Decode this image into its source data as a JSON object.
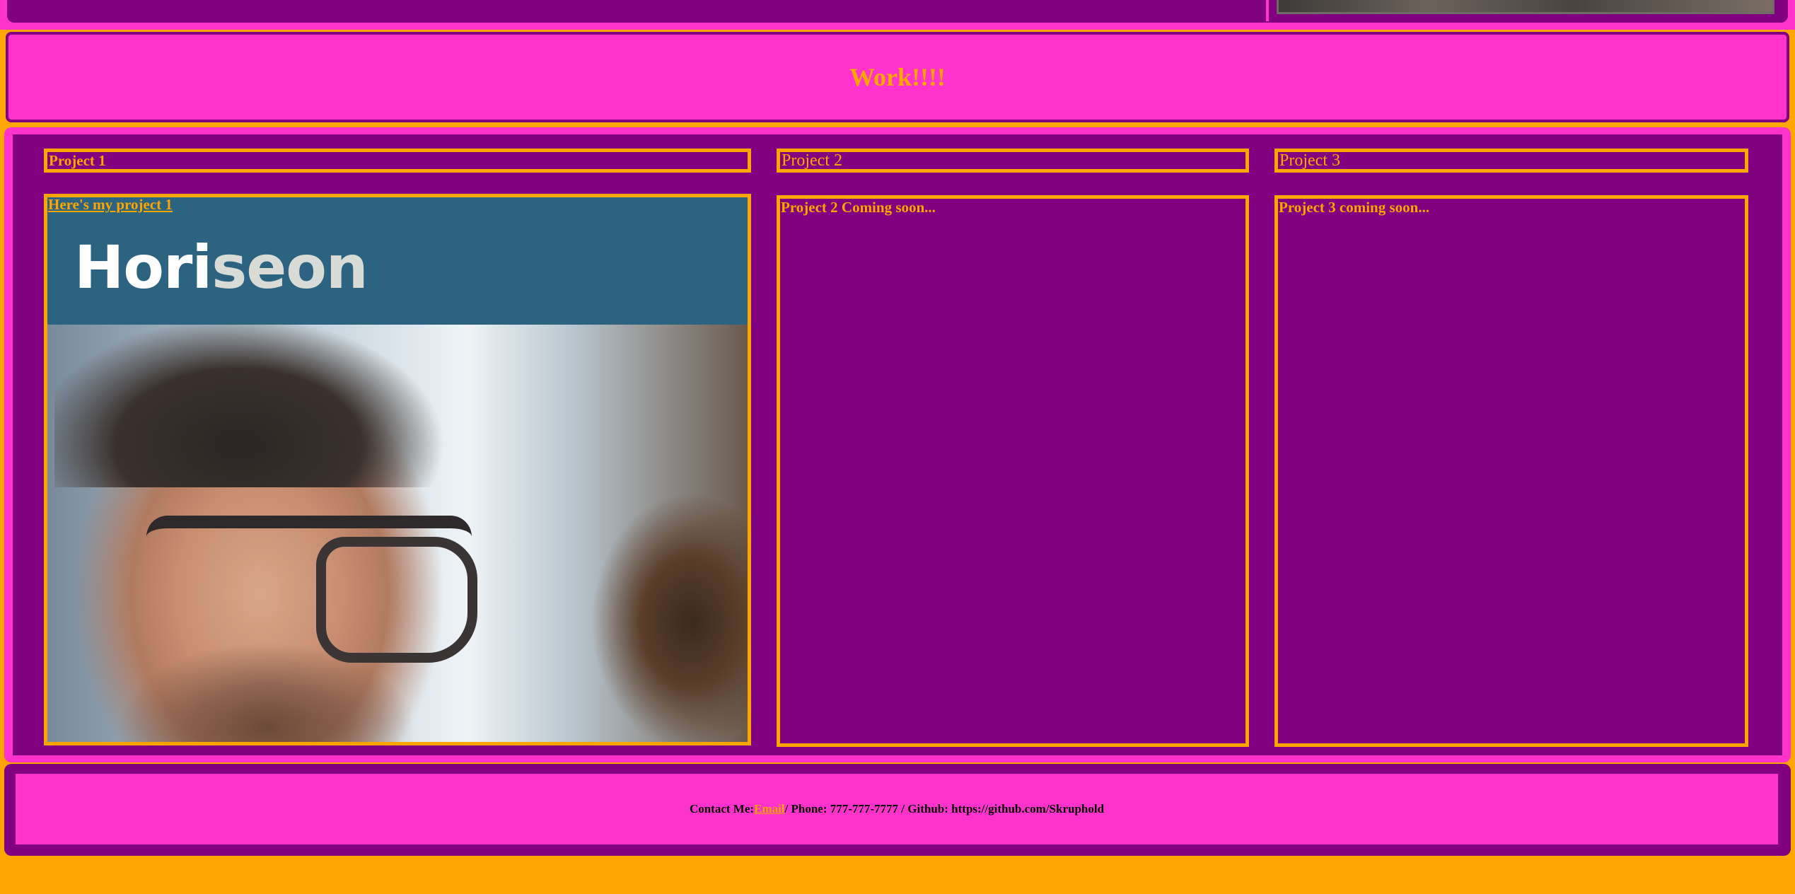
{
  "work_header": {
    "title": "Work!!!!"
  },
  "projects": [
    {
      "title": "Project 1",
      "caption": "Here's my project 1",
      "screenshot": {
        "logo_part1": "Hori",
        "logo_part2": "seon"
      }
    },
    {
      "title": "Project 2",
      "caption": "Project 2 Coming soon..."
    },
    {
      "title": "Project 3",
      "caption": "Project 3 coming soon..."
    }
  ],
  "contact": {
    "label": "Contact Me:",
    "email_link": "Email",
    "phone": " / Phone: 777-777-7777 / Github: https://github.com/Skruphold"
  },
  "colors": {
    "page_bg": "#FFA500",
    "panel_pink": "#FF33CC",
    "panel_purple": "#800080",
    "accent_orange": "#FFA500"
  }
}
